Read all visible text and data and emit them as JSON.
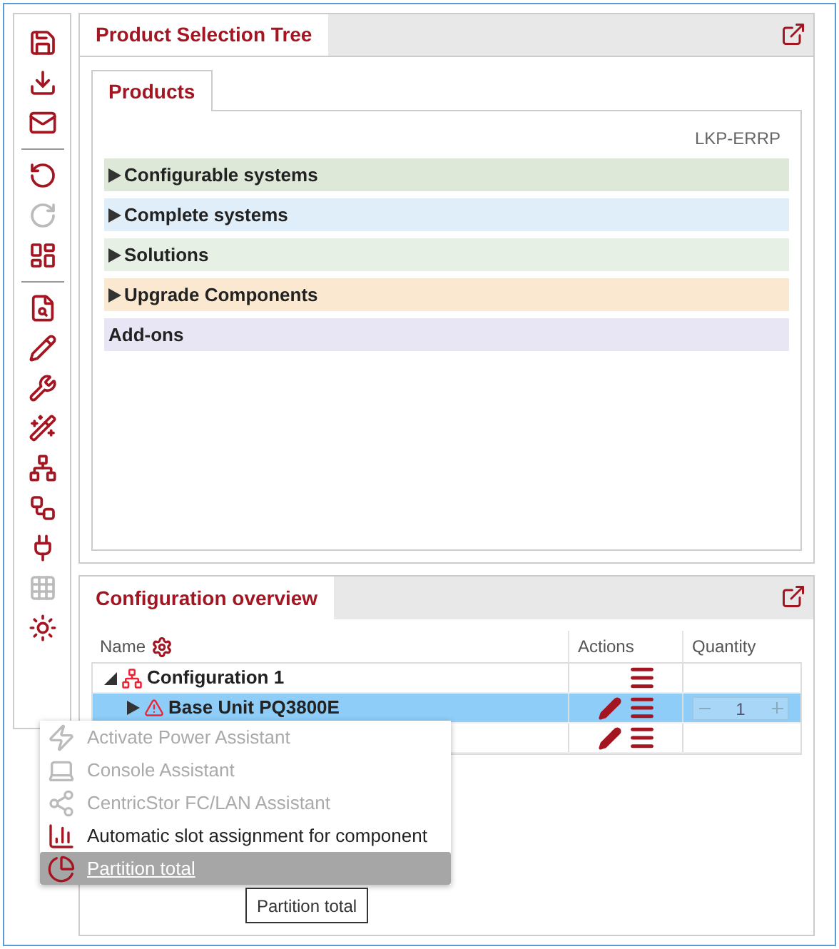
{
  "toolbar": [
    {
      "kind": "button",
      "disabled": false
    },
    {
      "kind": "button",
      "disabled": false
    },
    {
      "kind": "button",
      "disabled": false
    },
    {
      "kind": "separator"
    },
    {
      "kind": "button",
      "disabled": false
    },
    {
      "kind": "button",
      "disabled": true
    },
    {
      "kind": "button",
      "disabled": false
    },
    {
      "kind": "separator"
    },
    {
      "kind": "button",
      "disabled": false
    },
    {
      "kind": "button",
      "disabled": false
    },
    {
      "kind": "button",
      "disabled": false
    },
    {
      "kind": "button",
      "disabled": false
    },
    {
      "kind": "button",
      "disabled": false
    },
    {
      "kind": "button",
      "disabled": false
    },
    {
      "kind": "button",
      "disabled": false
    },
    {
      "kind": "button",
      "disabled": true
    },
    {
      "kind": "button",
      "disabled": false
    }
  ],
  "product_panel": {
    "title": "Product Selection Tree",
    "tab": {
      "label": "Products",
      "selected": true
    },
    "code": "LKP-ERRP",
    "categories": [
      {
        "label": "Configurable systems",
        "expandable": true,
        "color": "#dde8d8"
      },
      {
        "label": "Complete systems",
        "expandable": true,
        "color": "#e0eef9"
      },
      {
        "label": "Solutions",
        "expandable": true,
        "color": "#e7f0e4"
      },
      {
        "label": "Upgrade Components",
        "expandable": true,
        "color": "#fae8d0"
      },
      {
        "label": "Add-ons",
        "expandable": false,
        "color": "#e8e6f4"
      }
    ]
  },
  "configuration_panel": {
    "title": "Configuration overview",
    "columns": [
      "Name",
      "Actions",
      "Quantity"
    ],
    "rows": [
      {
        "name": "Configuration 1",
        "expanded": true,
        "selected": false,
        "editable": false
      },
      {
        "name": "Base Unit PQ3800E",
        "expanded": false,
        "selected": true,
        "editable": true,
        "quantity": "1"
      },
      {
        "selected": false,
        "editable": true
      }
    ]
  },
  "context_menu": {
    "items": [
      {
        "label": "Activate Power Assistant",
        "disabled": true,
        "selected": false
      },
      {
        "label": "Console Assistant",
        "disabled": true,
        "selected": false
      },
      {
        "label": "CentricStor FC/LAN Assistant",
        "disabled": true,
        "selected": false
      },
      {
        "label": "Automatic slot assignment for component",
        "disabled": false,
        "selected": false
      },
      {
        "label": "Partition total",
        "disabled": false,
        "selected": true
      }
    ]
  },
  "tooltip": "Partition total"
}
